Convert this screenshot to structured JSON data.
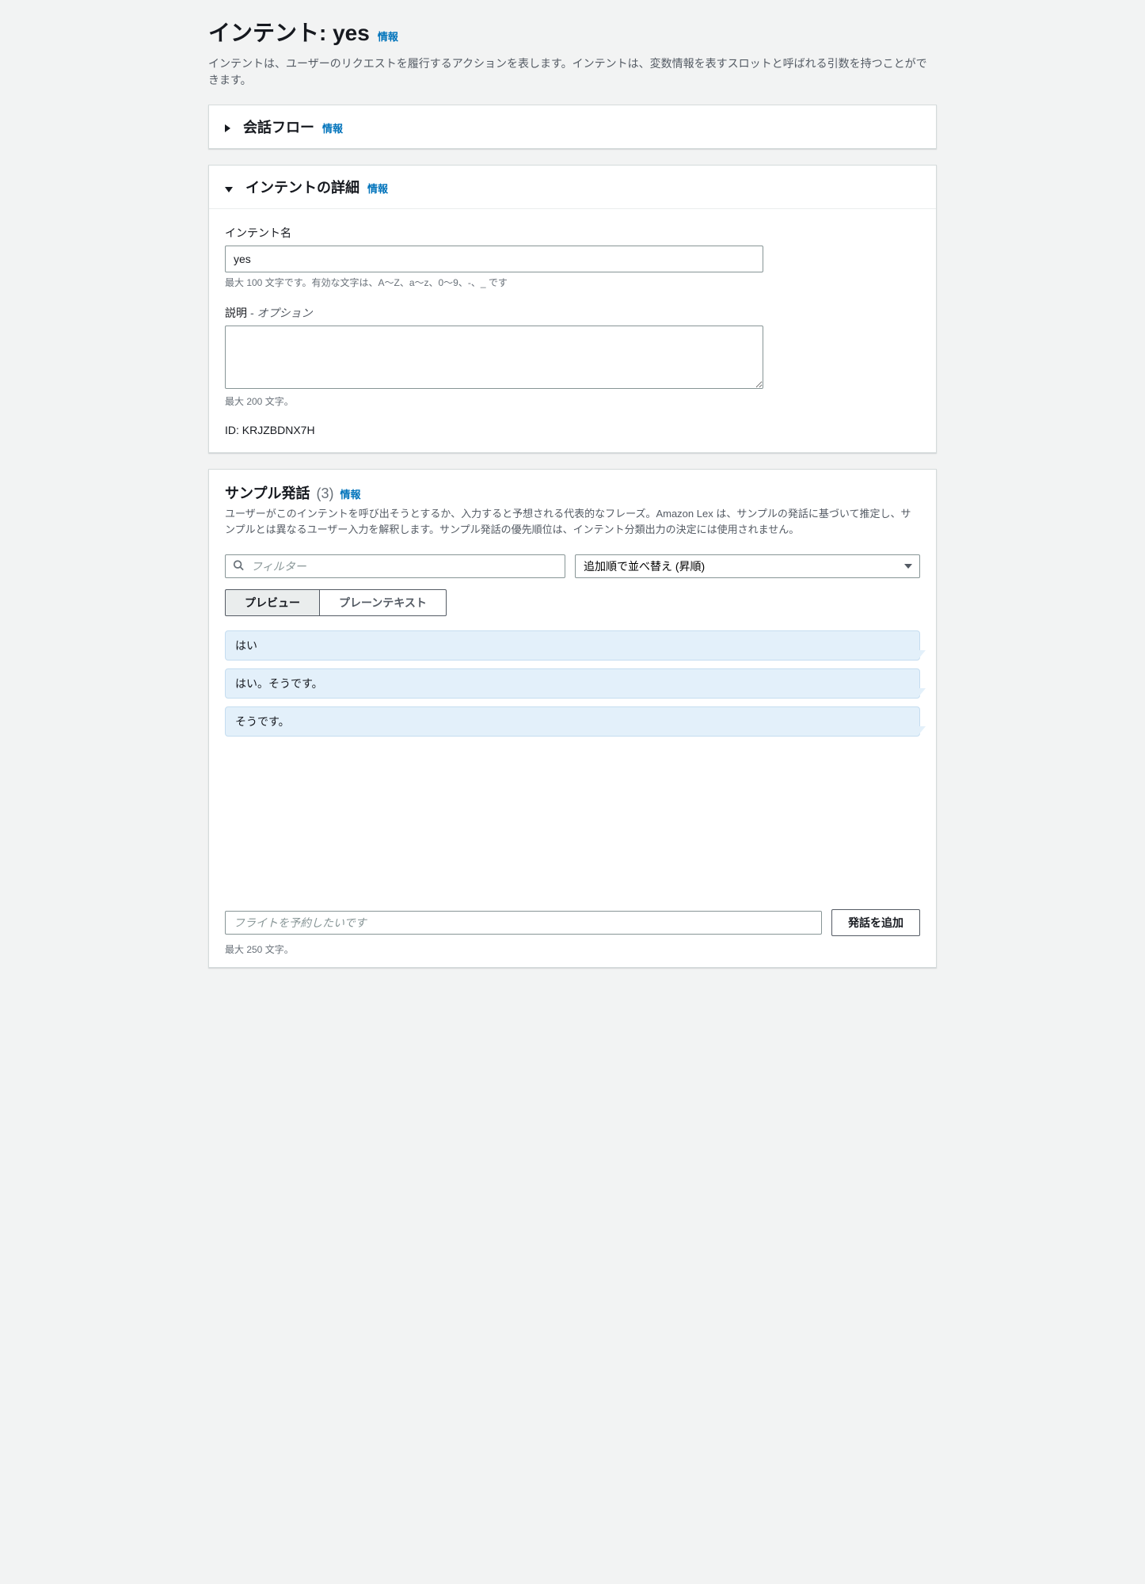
{
  "page": {
    "title_prefix": "インテント: ",
    "intent_name": "yes",
    "info_label": "情報",
    "description": "インテントは、ユーザーのリクエストを履行するアクションを表します。インテントは、変数情報を表すスロットと呼ばれる引数を持つことができます。"
  },
  "conversation_flow": {
    "title": "会話フロー",
    "info_label": "情報"
  },
  "intent_details": {
    "title": "インテントの詳細",
    "info_label": "情報",
    "name_label": "インテント名",
    "name_value": "yes",
    "name_hint": "最大 100 文字です。有効な文字は、A〜Z、a〜z、0〜9、-、_ です",
    "desc_label": "説明",
    "desc_optional": " - オプション",
    "desc_value": "",
    "desc_hint": "最大 200 文字。",
    "id_label": "ID: ",
    "id_value": "KRJZBDNX7H"
  },
  "sample_utterances": {
    "title": "サンプル発話",
    "count": "(3)",
    "info_label": "情報",
    "description": "ユーザーがこのインテントを呼び出そうとするか、入力すると予想される代表的なフレーズ。Amazon Lex は、サンプルの発話に基づいて推定し、サンプルとは異なるユーザー入力を解釈します。サンプル発話の優先順位は、インテント分類出力の決定には使用されません。",
    "filter_placeholder": "フィルター",
    "sort_selected": "追加順で並べ替え (昇順)",
    "toggle_preview": "プレビュー",
    "toggle_plaintext": "プレーンテキスト",
    "utterances": [
      "はい",
      "はい。そうです。",
      "そうです。"
    ],
    "add_placeholder": "フライトを予約したいです",
    "add_button": "発話を追加",
    "add_hint": "最大 250 文字。"
  }
}
